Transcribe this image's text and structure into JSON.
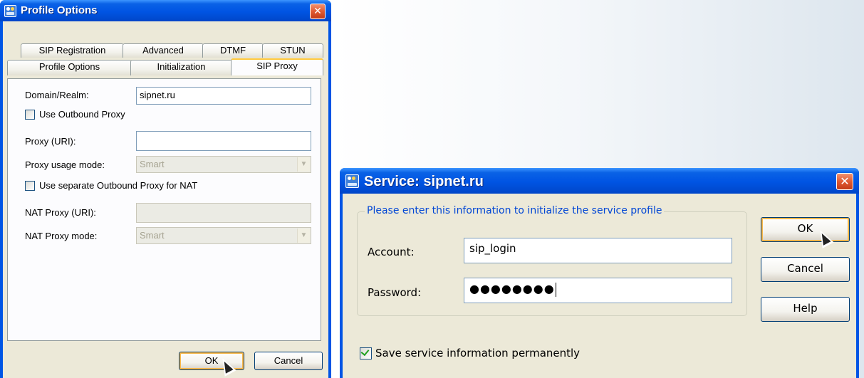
{
  "profile_dialog": {
    "title": "Profile Options",
    "close_glyph": "✕",
    "tabs_back_row": [
      "SIP Registration",
      "Advanced",
      "DTMF",
      "STUN"
    ],
    "tabs_front_row": [
      "Profile Options",
      "Initialization",
      "SIP Proxy"
    ],
    "active_tab": "SIP Proxy",
    "domain_label": "Domain/Realm:",
    "domain_value": "sipnet.ru",
    "use_outbound_proxy_label": "Use Outbound Proxy",
    "use_outbound_proxy_checked": false,
    "proxy_uri_label": "Proxy (URI):",
    "proxy_uri_value": "",
    "proxy_usage_mode_label": "Proxy usage mode:",
    "proxy_usage_mode_value": "Smart",
    "use_separate_nat_proxy_label": "Use separate Outbound Proxy for NAT",
    "use_separate_nat_proxy_checked": false,
    "nat_proxy_uri_label": "NAT Proxy (URI):",
    "nat_proxy_uri_value": "",
    "nat_proxy_mode_label": "NAT Proxy mode:",
    "nat_proxy_mode_value": "Smart",
    "ok_label": "OK",
    "cancel_label": "Cancel"
  },
  "service_dialog": {
    "title": "Service: sipnet.ru",
    "close_glyph": "✕",
    "group_legend": "Please enter this information to initialize the service profile",
    "account_label": "Account:",
    "account_value": "sip_login",
    "password_label": "Password:",
    "password_value": "●●●●●●●●",
    "ok_label": "OK",
    "cancel_label": "Cancel",
    "help_label": "Help",
    "save_permanently_label": "Save service information permanently",
    "save_permanently_checked": true
  },
  "icons": {
    "app": "app-logo-icon",
    "close": "close-icon",
    "combo_arrow": "chevron-down-icon",
    "cursor": "mouse-pointer-icon"
  }
}
